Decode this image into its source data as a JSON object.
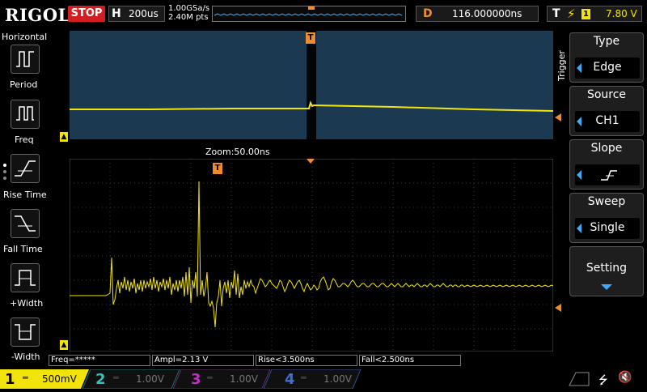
{
  "header": {
    "brand": "RIGOL",
    "run_state": "STOP",
    "timebase_letter": "H",
    "timebase_value": "200us",
    "sample_rate": "1.00GSa/s",
    "memory_depth": "2.40M pts",
    "delay_letter": "D",
    "delay_value": "116.000000ns",
    "trigger_letter": "T",
    "trigger_channel": "1",
    "trigger_level": "7.80 V"
  },
  "left_menu": {
    "title": "Horizontal",
    "items": [
      {
        "label": "Period",
        "icon": "period-icon"
      },
      {
        "label": "Freq",
        "icon": "freq-icon"
      },
      {
        "label": "Rise Time",
        "icon": "rise-time-icon"
      },
      {
        "label": "Fall Time",
        "icon": "fall-time-icon"
      },
      {
        "label": "+Width",
        "icon": "plus-width-icon"
      },
      {
        "label": "-Width",
        "icon": "minus-width-icon"
      }
    ]
  },
  "screen": {
    "zoom_label": "Zoom:50.00ns",
    "trigger_marker": "T",
    "channel_marker": "1"
  },
  "measurements": [
    {
      "label": "Freq=*****"
    },
    {
      "label": "Ampl=2.13 V"
    },
    {
      "label": "Rise<3.500ns"
    },
    {
      "label": "Fall<2.500ns"
    }
  ],
  "right_menu": {
    "title": "Trigger",
    "items": [
      {
        "title": "Type",
        "value": "Edge"
      },
      {
        "title": "Source",
        "value": "CH1"
      },
      {
        "title": "Slope",
        "value": ""
      },
      {
        "title": "Sweep",
        "value": "Single"
      }
    ],
    "setting": "Setting"
  },
  "channels": [
    {
      "num": "1",
      "scale": "500mV",
      "color": "#f2e40a",
      "active": true
    },
    {
      "num": "2",
      "scale": "1.00V",
      "color": "#2fc2c2",
      "active": false
    },
    {
      "num": "3",
      "scale": "1.00V",
      "color": "#c02fc2",
      "active": false
    },
    {
      "num": "4",
      "scale": "1.00V",
      "color": "#3f6fd8",
      "active": false
    }
  ],
  "colors": {
    "ch1": "#f2e40a",
    "trigger_marker": "#f28c28",
    "stop_bg": "#d21e1e",
    "zoom_bg": "#1b3a52",
    "menu_arrow": "#3fa9f5"
  }
}
